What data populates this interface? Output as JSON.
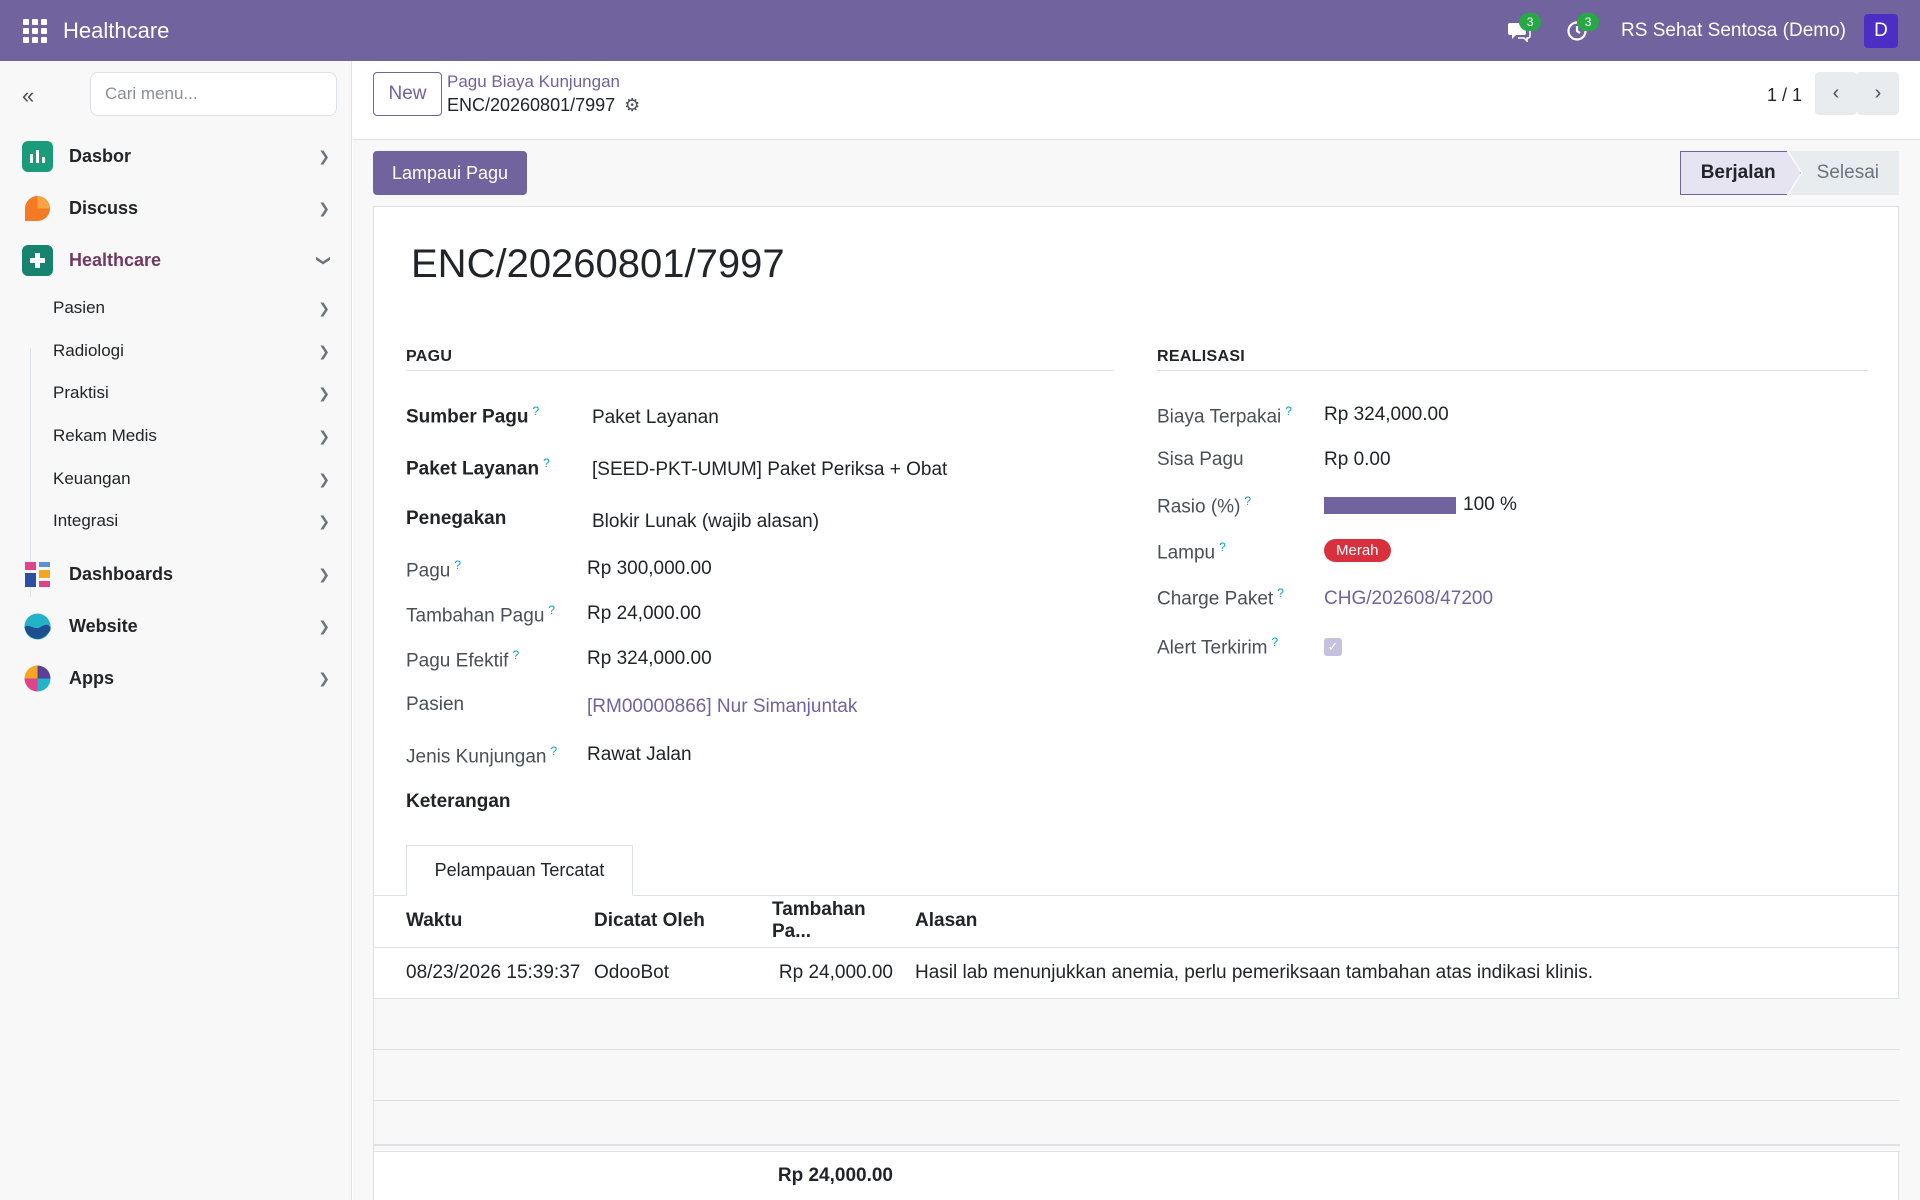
{
  "topbar": {
    "app_name": "Healthcare",
    "messages_count": "3",
    "activities_count": "3",
    "company": "RS Sehat Sentosa (Demo)",
    "user_initial": "D"
  },
  "sidebar": {
    "search_placeholder": "Cari menu...",
    "items": [
      {
        "label": "Dasbor",
        "icon": "chart-icon"
      },
      {
        "label": "Discuss",
        "icon": "discuss-icon"
      },
      {
        "label": "Healthcare",
        "icon": "plus-icon"
      },
      {
        "label": "Dashboards",
        "icon": "dashboards-icon"
      },
      {
        "label": "Website",
        "icon": "website-icon"
      },
      {
        "label": "Apps",
        "icon": "apps-icon"
      }
    ],
    "sub_items": [
      "Pasien",
      "Radiologi",
      "Praktisi",
      "Rekam Medis",
      "Keuangan",
      "Integrasi"
    ]
  },
  "control": {
    "new_label": "New",
    "breadcrumb_parent": "Pagu Biaya Kunjungan",
    "breadcrumb_current": "ENC/20260801/7997",
    "pager": "1 / 1"
  },
  "actions": {
    "primary_label": "Lampaui Pagu",
    "status_current": "Berjalan",
    "status_next": "Selesai"
  },
  "record": {
    "title": "ENC/20260801/7997",
    "pagu_section": "PAGU",
    "realisasi_section": "REALISASI",
    "left": {
      "sumber_pagu_label": "Sumber Pagu",
      "sumber_pagu_value": "Paket Layanan",
      "paket_label": "Paket Layanan",
      "paket_value": "[SEED-PKT-UMUM] Paket Periksa + Obat",
      "penegakan_label": "Penegakan",
      "penegakan_value": "Blokir Lunak (wajib alasan)",
      "pagu_label": "Pagu",
      "pagu_value": "Rp 300,000.00",
      "tambahan_label": "Tambahan Pagu",
      "tambahan_value": "Rp 24,000.00",
      "efektif_label": "Pagu Efektif",
      "efektif_value": "Rp 324,000.00",
      "pasien_label": "Pasien",
      "pasien_value": "[RM00000866] Nur Simanjuntak",
      "jenis_label": "Jenis Kunjungan",
      "jenis_value": "Rawat Jalan",
      "keterangan_label": "Keterangan"
    },
    "right": {
      "biaya_label": "Biaya Terpakai",
      "biaya_value": "Rp 324,000.00",
      "sisa_label": "Sisa Pagu",
      "sisa_value": "Rp 0.00",
      "rasio_label": "Rasio (%)",
      "rasio_value": "100 %",
      "rasio_fraction": 1.0,
      "lampu_label": "Lampu",
      "lampu_value": "Merah",
      "charge_label": "Charge Paket",
      "charge_value": "CHG/202608/47200",
      "alert_label": "Alert Terkirim",
      "alert_checked": true
    },
    "help_mark": "?"
  },
  "tab": {
    "label": "Pelampauan Tercatat",
    "columns": [
      "Waktu",
      "Dicatat Oleh",
      "Tambahan Pa...",
      "Alasan"
    ],
    "rows": [
      {
        "waktu": "08/23/2026 15:39:37",
        "oleh": "OdooBot",
        "tambahan": "Rp 24,000.00",
        "alasan": "Hasil lab menunjukkan anemia, perlu pemeriksaan tambahan atas indikasi klinis."
      }
    ],
    "total": "Rp 24,000.00"
  },
  "colors": {
    "brand": "#71639e",
    "danger": "#d9303e",
    "badge_green": "#28a745"
  }
}
